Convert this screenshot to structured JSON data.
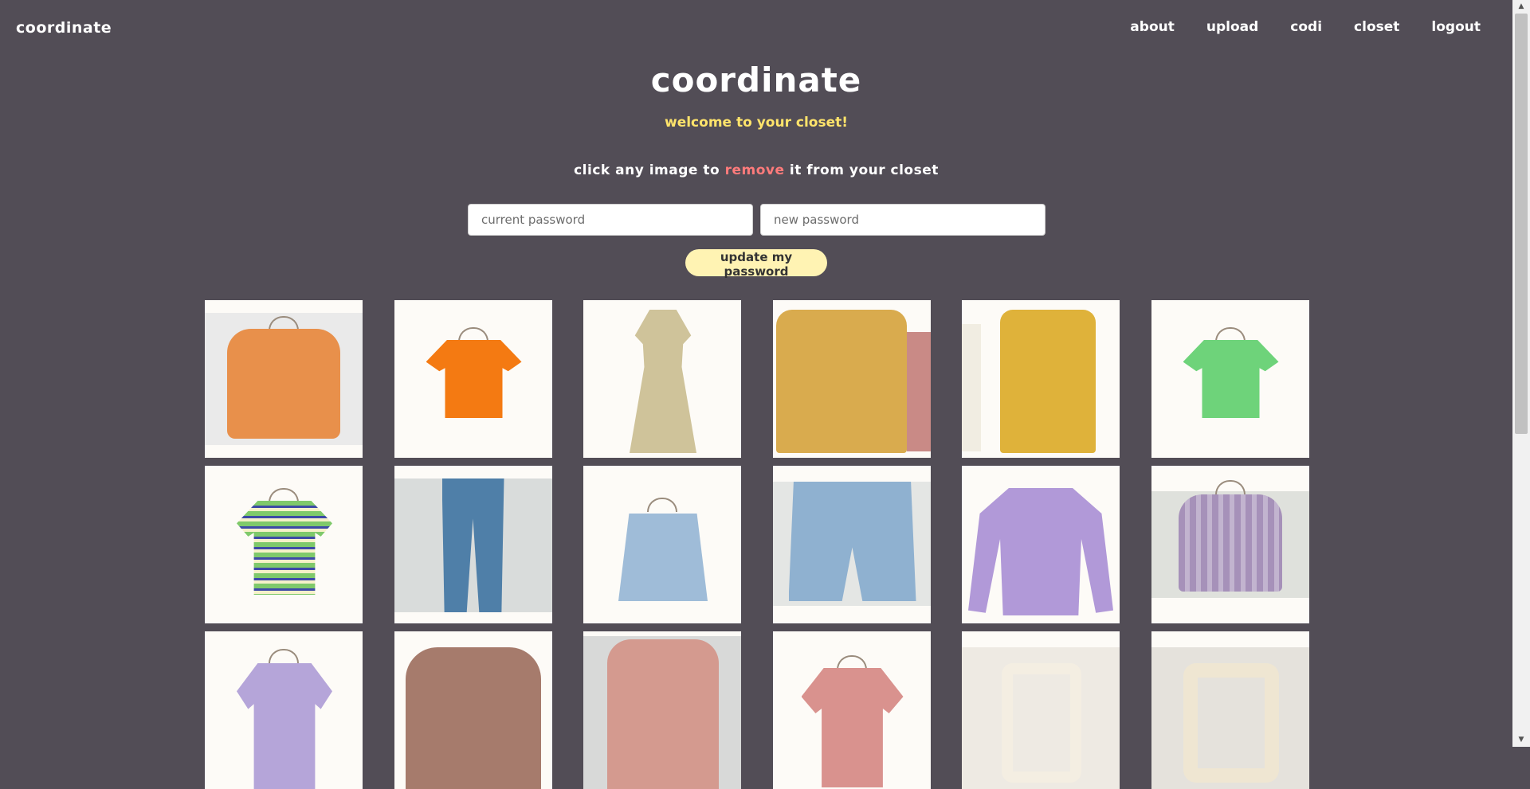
{
  "nav": {
    "brand": "coordinate",
    "links": [
      "about",
      "upload",
      "codi",
      "closet",
      "logout"
    ]
  },
  "header": {
    "title": "coordinate",
    "welcome": "welcome to your closet!",
    "instruction_before": "click any image to ",
    "instruction_action": "remove",
    "instruction_after": " it from your closet"
  },
  "password_form": {
    "current_placeholder": "current password",
    "new_placeholder": "new password",
    "submit_label": "update my password"
  },
  "closet_items": [
    "orange-knit-sweater",
    "orange-tshirt",
    "floral-dress",
    "mustard-shirt",
    "yellow-knit-polo",
    "green-smiley-tshirt",
    "striped-tshirt",
    "blue-jeans",
    "denim-skirt",
    "denim-shorts",
    "lavender-longsleeve",
    "plaid-blouse",
    "lavender-polo",
    "floral-blouse",
    "floral-long-dress",
    "pink-tshirt",
    "cream-hair-claw",
    "marble-hair-claw"
  ],
  "colors": {
    "background": "#524d56",
    "accent_yellow": "#ffe46b",
    "remove_red": "#ff7b7b",
    "button_bg": "#fff3b3"
  }
}
